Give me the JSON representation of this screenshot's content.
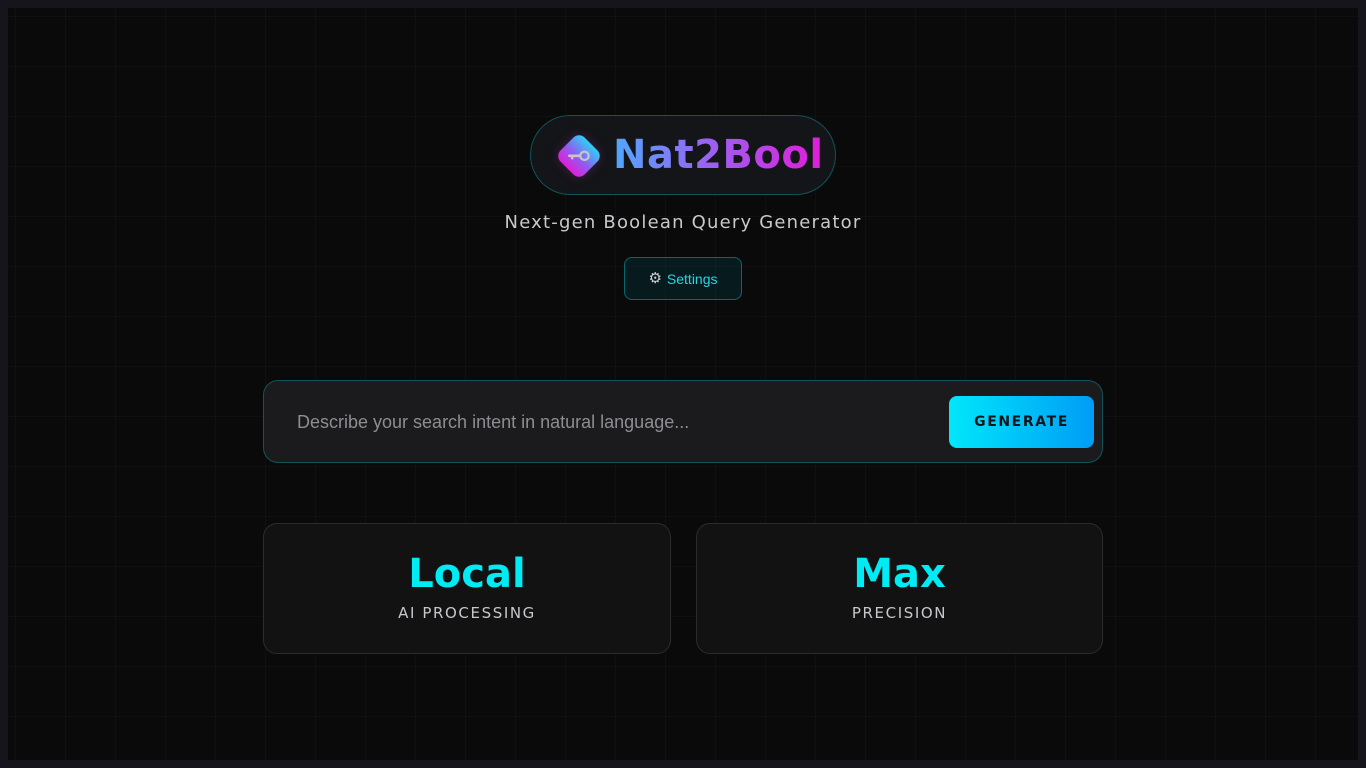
{
  "brand": {
    "name": "Nat2Bool",
    "subtitle": "Next-gen Boolean Query Generator",
    "icon": "key-icon",
    "gradient": [
      "#4fa8ff",
      "#9a62f2",
      "#e21cd8"
    ]
  },
  "settings": {
    "label": "Settings",
    "icon": "gear-icon"
  },
  "search": {
    "placeholder": "Describe your search intent in natural language...",
    "value": "",
    "button_label": "GENERATE"
  },
  "stats": [
    {
      "value": "Local",
      "label": "AI PROCESSING"
    },
    {
      "value": "Max",
      "label": "PRECISION"
    }
  ],
  "colors": {
    "accent": "#00ecf5",
    "background": "#0a0a0b",
    "button_gradient_start": "#00e7fb",
    "button_gradient_end": "#009cf6"
  }
}
